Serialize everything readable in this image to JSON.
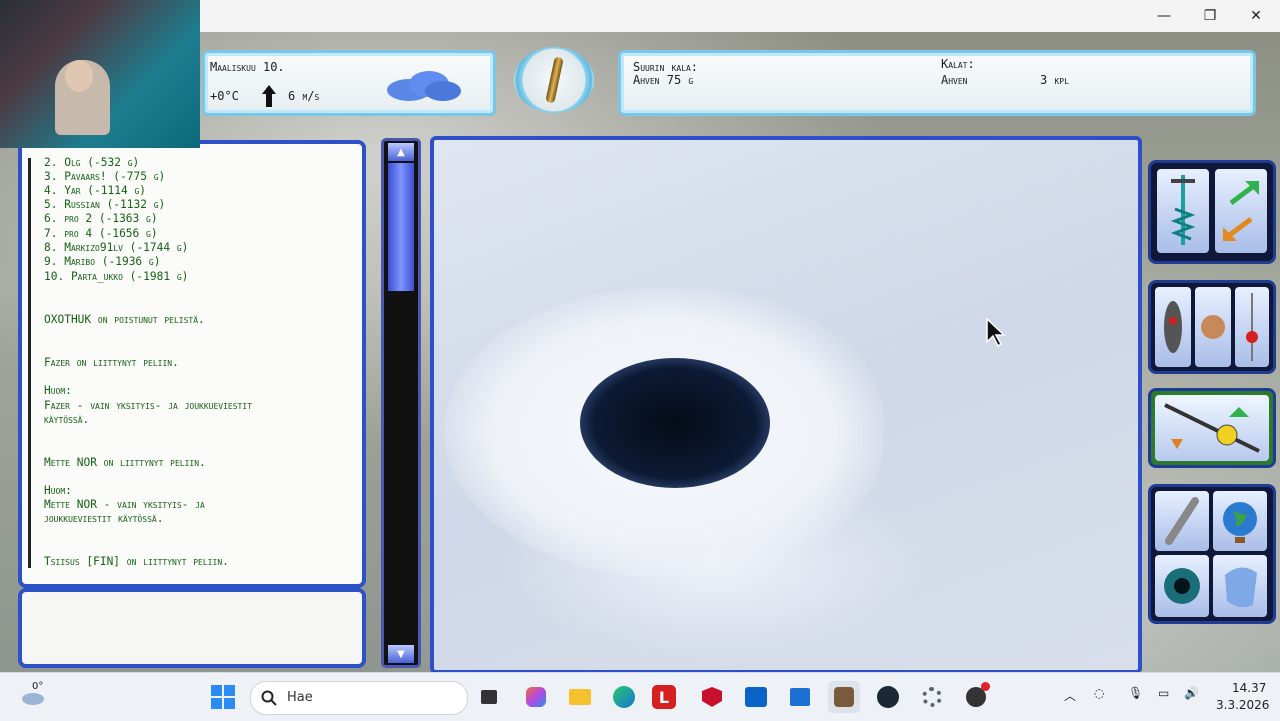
{
  "window": {
    "minimize": "—",
    "maximize": "❐",
    "close": "✕"
  },
  "weather": {
    "date": "Maaliskuu 10.",
    "temp": "+0°C",
    "wind": "6 m/s"
  },
  "fish": {
    "largest_label": "Suurin kala:",
    "largest_value": "Ahven 75 g",
    "catch_label": "Kalat:",
    "catch_species": "Ahven",
    "catch_count": "3 kpl"
  },
  "chat": {
    "lines": [
      "2. Olg (-532 g)",
      "3. Pavaars! (-775 g)",
      "4. Yar (-1114 g)",
      "5. Russian (-1132 g)",
      "6. pro 2 (-1363 g)",
      "7. pro 4 (-1656 g)",
      "8. Markizo91lv (-1744 g)",
      "9. Maribo (-1936 g)",
      "10. Parta_ukko (-1981 g)",
      "OXOTHUK on poistunut pelistä.",
      "Fazer on liittynyt peliin.",
      "Huom:",
      "Fazer - vain yksityis- ja joukkueviestit",
      "käytössä.",
      "Mette NOR on liittynyt peliin.",
      "Huom:",
      "Mette NOR - vain yksityis- ja",
      "joukkueviestit käytössä.",
      "Tsiisus [FIN] on liittynyt peliin."
    ]
  },
  "taskbar": {
    "weather_temp": "0°",
    "search_placeholder": "Hae",
    "time": "14.37",
    "date": "3.3.2026"
  }
}
